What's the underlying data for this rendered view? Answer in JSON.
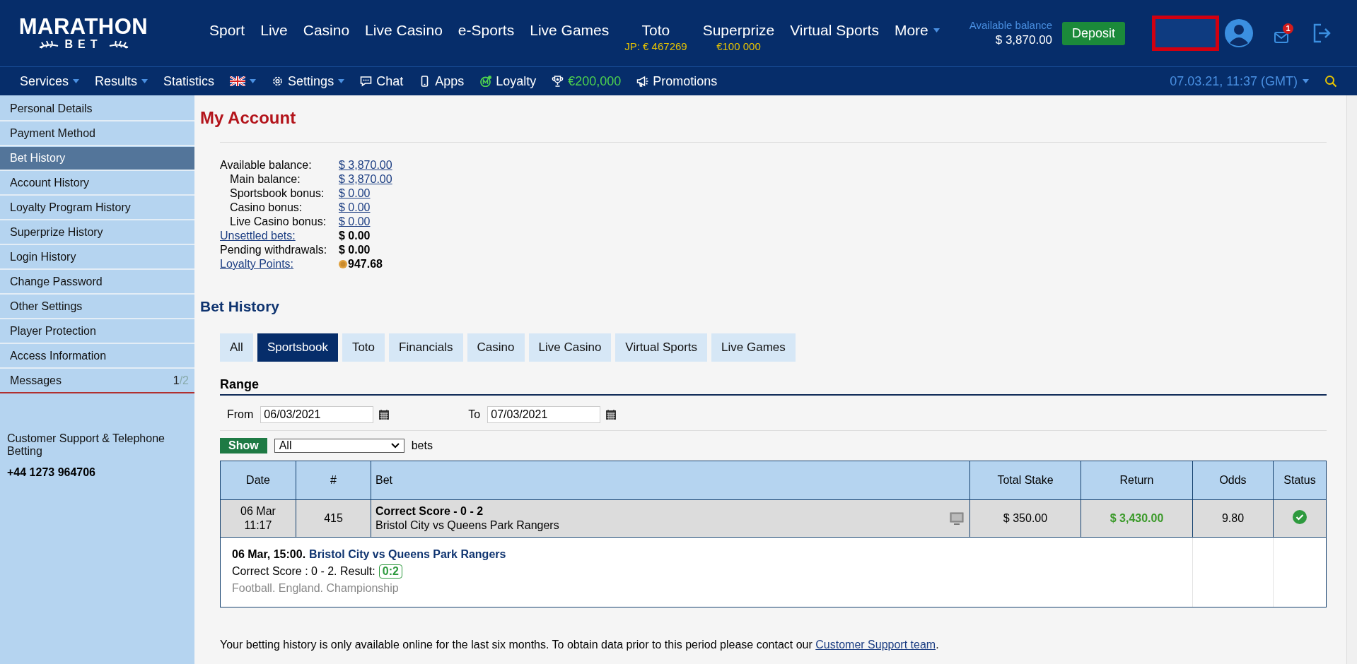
{
  "logo": {
    "line1": "MARATHON",
    "line2": "BET"
  },
  "nav": [
    {
      "label": "Sport"
    },
    {
      "label": "Live"
    },
    {
      "label": "Casino"
    },
    {
      "label": "Live Casino"
    },
    {
      "label": "e-Sports"
    },
    {
      "label": "Live Games"
    },
    {
      "label": "Toto",
      "sub": "JP: € 467269"
    },
    {
      "label": "Superprize",
      "sub": "€100 000"
    },
    {
      "label": "Virtual Sports"
    },
    {
      "label": "More",
      "dropdown": true
    }
  ],
  "balance": {
    "label": "Available balance",
    "amount": "$ 3,870.00"
  },
  "deposit": "Deposit",
  "mail_badge": "1",
  "subnav": [
    {
      "kind": "menu",
      "label": "Services"
    },
    {
      "kind": "menu",
      "label": "Results"
    },
    {
      "kind": "link",
      "label": "Statistics"
    },
    {
      "kind": "flag"
    },
    {
      "kind": "settings",
      "label": "Settings"
    },
    {
      "kind": "chat",
      "label": "Chat"
    },
    {
      "kind": "apps",
      "label": "Apps"
    },
    {
      "kind": "loyalty",
      "label": "Loyalty"
    },
    {
      "kind": "prize",
      "label": "€200,000"
    },
    {
      "kind": "promo",
      "label": "Promotions"
    }
  ],
  "datetime": "07.03.21, 11:37 (GMT)",
  "sidebar": {
    "items": [
      {
        "label": "Personal Details",
        "selected": false
      },
      {
        "label": "Payment Method",
        "selected": false
      },
      {
        "label": "Bet History",
        "selected": true
      },
      {
        "label": "Account History",
        "selected": false
      },
      {
        "label": "Loyalty Program History",
        "selected": false
      },
      {
        "label": "Superprize History",
        "selected": false
      },
      {
        "label": "Login History",
        "selected": false
      },
      {
        "label": "Change Password",
        "selected": false
      },
      {
        "label": "Other Settings",
        "selected": false
      },
      {
        "label": "Player Protection",
        "selected": false
      },
      {
        "label": "Access Information",
        "selected": false
      },
      {
        "label": "Messages",
        "selected": false,
        "unread": "1",
        "total": "/2"
      }
    ],
    "support": "Customer Support & Telephone Betting",
    "phone": "+44 1273 964706"
  },
  "account": {
    "title": "My Account",
    "rows": [
      {
        "label": "Available balance:",
        "value": "$ 3,870.00",
        "kind": "link-value"
      },
      {
        "label": "Main balance:",
        "value": "$ 3,870.00",
        "kind": "sub"
      },
      {
        "label": "Sportsbook bonus:",
        "value": "$ 0.00",
        "kind": "sub"
      },
      {
        "label": "Casino bonus:",
        "value": "$ 0.00",
        "kind": "sub"
      },
      {
        "label": "Live Casino bonus:",
        "value": "$ 0.00",
        "kind": "sub"
      },
      {
        "label": "Unsettled bets:",
        "value": "$ 0.00",
        "kind": "link-label"
      },
      {
        "label": "Pending withdrawals:",
        "value": "$ 0.00",
        "kind": "plain"
      },
      {
        "label": "Loyalty Points:",
        "value": "947.68",
        "kind": "points"
      }
    ]
  },
  "bet_history": {
    "title": "Bet History",
    "tabs": [
      {
        "label": "All",
        "selected": false
      },
      {
        "label": "Sportsbook",
        "selected": true
      },
      {
        "label": "Toto",
        "selected": false
      },
      {
        "label": "Financials",
        "selected": false
      },
      {
        "label": "Casino",
        "selected": false
      },
      {
        "label": "Live Casino",
        "selected": false
      },
      {
        "label": "Virtual Sports",
        "selected": false
      },
      {
        "label": "Live Games",
        "selected": false
      }
    ],
    "range": {
      "title": "Range",
      "from_label": "From",
      "from": "06/03/2021",
      "to_label": "To",
      "to": "07/03/2021"
    },
    "show": "Show",
    "filter": "All",
    "filter_suffix": "bets",
    "columns": [
      "Date",
      "#",
      "Bet",
      "Total Stake",
      "Return",
      "Odds",
      "Status"
    ],
    "rows": [
      {
        "date": "06 Mar",
        "time": "11:17",
        "number": "415",
        "bet": "Correct Score - 0 - 2",
        "match": "Bristol City vs Queens Park Rangers",
        "stake": "$ 350.00",
        "return": "$ 3,430.00",
        "odds": "9.80",
        "won": true,
        "detail": {
          "when": "06 Mar, 15:00.",
          "event": "Bristol City vs Queens Park Rangers",
          "outcome": "Correct Score : 0 - 2. Result:",
          "score": "0:2",
          "category": "Football. England. Championship"
        }
      }
    ],
    "note": "Your betting history is only available online for the last six months. To obtain data prior to this period please contact our",
    "note_link": "Customer Support team",
    "note_end": "."
  }
}
